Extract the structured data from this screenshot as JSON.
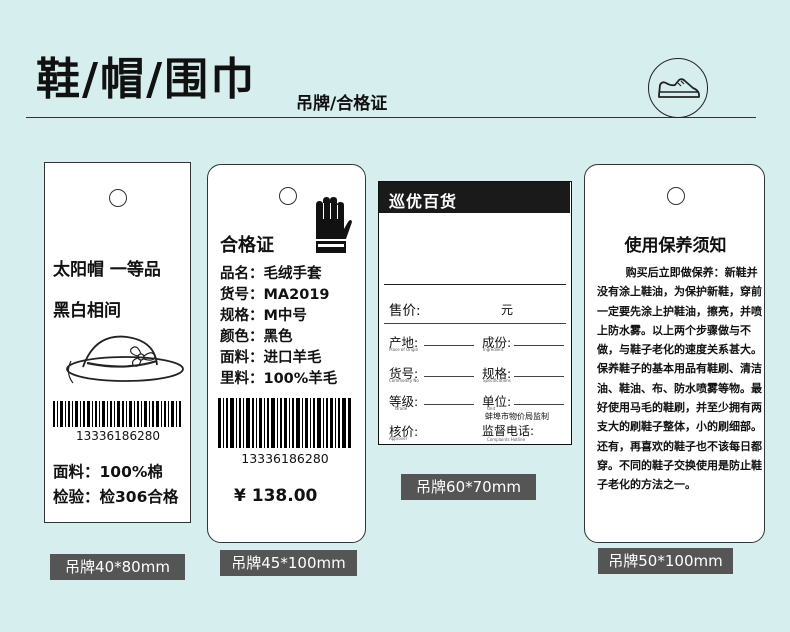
{
  "header": {
    "title": "鞋/帽/围巾",
    "subtitle": "吊牌/合格证"
  },
  "tag1": {
    "line1": "太阳帽 一等品",
    "line2": "黑白相间",
    "barcode_number": "13336186280",
    "material": "面料：100%棉",
    "inspection": "检验：检306合格",
    "caption": "吊牌40*80mm"
  },
  "tag2": {
    "heading": "合格证",
    "rows": [
      "品名：毛绒手套",
      "货号：MA2019",
      "规格：M中号",
      "颜色：黑色",
      "面料：进口羊毛",
      "里料：100%羊毛"
    ],
    "barcode_number": "13336186280",
    "price": "¥ 138.00",
    "caption": "吊牌45*100mm"
  },
  "tag3": {
    "brand": "巡优百货",
    "price_label": "售价:",
    "price_unit": "元",
    "origin_label": "产地:",
    "origin_sub": "Place of Origin",
    "ingredient_label": "成份:",
    "ingredient_sub": "Ingredient",
    "item_no_label": "货号:",
    "item_no_sub": "Commodity No",
    "spec_label": "规格:",
    "spec_sub": "Specifications",
    "grade_label": "等级:",
    "grade_sub": "Grade",
    "unit_label": "单位:",
    "unit_sub": "Unit",
    "supervisor": "蚌埠市物价局监制",
    "approver_label": "核价:",
    "approver_sub": "Approver",
    "hotline_label": "监督电话:",
    "hotline_sub": "Complaints Hotline",
    "caption": "吊牌60*70mm"
  },
  "tag4": {
    "heading": "使用保养须知",
    "body": "购买后立即做保养：新鞋并没有涂上鞋油，为保护新鞋，穿前一定要先涂上护鞋油，擦亮，并喷上防水雾。以上两个步骤做与不做，与鞋子老化的速度关系甚大。保养鞋子的基本用品有鞋刷、清洁油、鞋油、布、防水喷雾等物。最好使用马毛的鞋刷，并至少拥有两支大的刷鞋子整体，小的刷细部。还有，再喜欢的鞋子也不该每日都穿。不同的鞋子交换使用是防止鞋子老化的方法之一。",
    "caption": "吊牌50*100mm"
  },
  "icons": [
    "shoe-icon",
    "hat-icon",
    "glove-icon"
  ],
  "colors": {
    "background": "#d7eeee",
    "caption_box": "#555555",
    "tag3_header": "#1a1a1a"
  }
}
